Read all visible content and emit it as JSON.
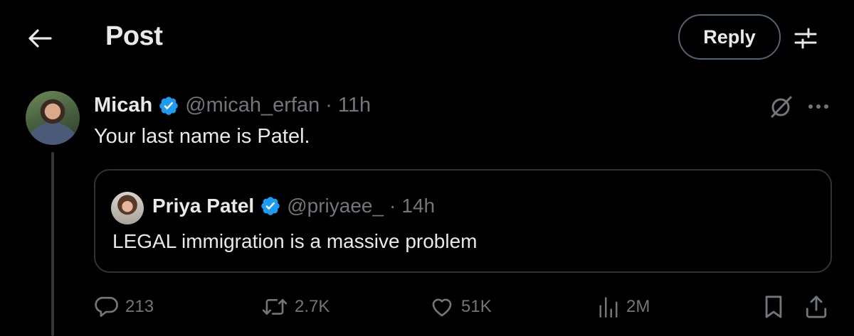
{
  "header": {
    "title": "Post",
    "reply_label": "Reply",
    "back_icon": "arrow-left-icon",
    "settings_icon": "sliders-icon"
  },
  "post": {
    "author_name": "Micah",
    "handle": "@micah_erfan",
    "separator": "·",
    "time": "11h",
    "text": "Your last name is Patel.",
    "verified": true
  },
  "quote": {
    "author_name": "Priya Patel",
    "handle": "@priyaee_",
    "separator": "·",
    "time": "14h",
    "text": "LEGAL immigration is a massive problem",
    "verified": true
  },
  "actions": {
    "replies": "213",
    "reposts": "2.7K",
    "likes": "51K",
    "views": "2M"
  },
  "colors": {
    "background": "#000000",
    "text": "#e7e9ea",
    "muted": "#71767b",
    "verified": "#1d9bf0",
    "border": "#2f3336"
  }
}
